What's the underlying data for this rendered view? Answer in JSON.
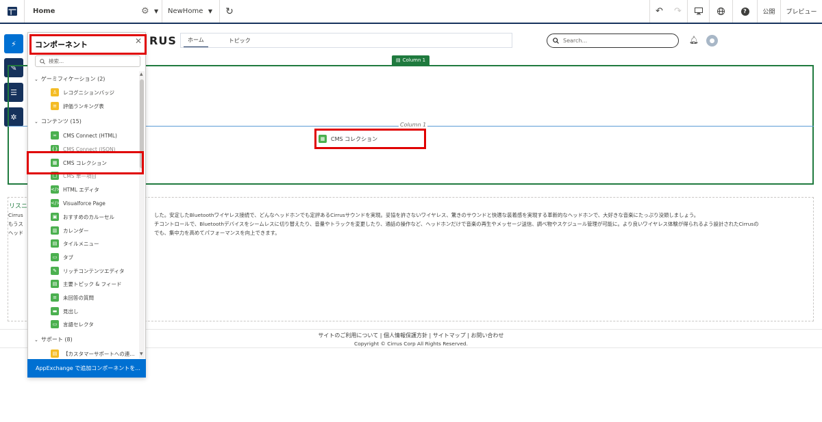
{
  "topbar": {
    "page_name": "Home",
    "version_name": "NewHome",
    "publish_label": "公開",
    "preview_label": "プレビュー"
  },
  "icons": [
    "app-grid-icon",
    "gear-icon",
    "chevron-down-icon",
    "refresh-icon",
    "undo-icon",
    "redo-icon",
    "desktop-icon",
    "globe-icon",
    "help-icon",
    "lightning-icon",
    "brush-icon",
    "list-icon",
    "settings-icon",
    "close-icon",
    "search-icon",
    "bell-icon",
    "avatar-icon"
  ],
  "canvas": {
    "logo_text": "RUS",
    "nav_home": "ホーム",
    "nav_topic": "トピック",
    "search_placeholder": "Search...",
    "column_badge": "Column 1",
    "column_label": "Column 1",
    "dropped_component": "CMS コレクション"
  },
  "rich_text": {
    "heading": "リスニ",
    "line1_left": "Cirrus",
    "line1": "した。安定したBluetoothワイヤレス接続で、どんなヘッドホンでも定評あるCirrusサウンドを実現。妥協を許さないワイヤレス、驚きのサウンドと快適な装着感を実現する革新的なヘッドホンで、大好きな音楽にたっぷり没頭しましょう。",
    "line2_left": "もうス",
    "line2": "チコントロールで、Bluetoothデバイスをシームレスに切り替えたり、音量やトラックを変更したり、通話の操作など、ヘッドホンだけで音楽の再生やメッセージ送信、調べ物やスケジュール管理が可能に。より良いワイヤレス体験が得られるよう設計されたCirrusの",
    "line3_left": "ヘッド",
    "line3": "でも、集中力を高めてパフォーマンスを向上できます。"
  },
  "footer": {
    "links": "サイトのご利用について | 個人情報保護方針 | サイトマップ | お問い合わせ",
    "copyright": "Copyright © Cirrus Corp All Rights Reserved."
  },
  "panel": {
    "title": "コンポーネント",
    "search_placeholder": "検索...",
    "groups": [
      {
        "label": "ゲーミフィケーション (2)",
        "items": [
          "レコグニションバッジ",
          "評価ランキング表"
        ]
      },
      {
        "label": "コンテンツ (15)",
        "items": [
          "CMS Connect (HTML)",
          "CMS Connect (JSON)",
          "CMS コレクション",
          "CMS 単一項目",
          "HTML エディタ",
          "Visualforce Page",
          "おすすめのカルーセル",
          "カレンダー",
          "タイルメニュー",
          "タブ",
          "リッチコンテンツエディタ",
          "主要トピック & フィード",
          "未回答の質問",
          "見出し",
          "言語セレクタ"
        ]
      },
      {
        "label": "サポート (8)",
        "items": [
          "【カスタマーサポートへの連..."
        ]
      }
    ],
    "appexchange": "AppExchange で追加コンポーネントを..."
  }
}
